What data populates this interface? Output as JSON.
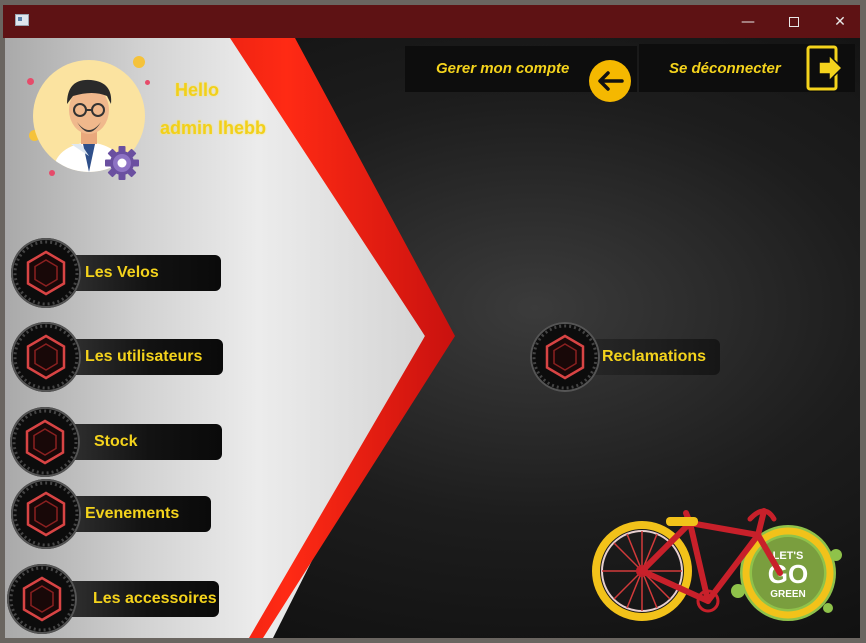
{
  "window": {
    "minimize_glyph": "—",
    "close_glyph": "✕"
  },
  "user": {
    "greeting": "Hello",
    "name": "admin lhebb"
  },
  "header": {
    "account_label": "Gerer mon compte",
    "logout_label": "Se déconnecter"
  },
  "menu": {
    "items": [
      {
        "label": "Les Velos"
      },
      {
        "label": "Les utilisateurs"
      },
      {
        "label": "Stock"
      },
      {
        "label": "Evenements"
      },
      {
        "label": "Les accessoires"
      }
    ],
    "reclamations_label": "Reclamations"
  },
  "badge": {
    "line1": "LET'S",
    "line2": "GO",
    "line3": "GREEN"
  },
  "colors": {
    "accent_yellow": "#f4d31c",
    "red": "#ff2a14",
    "title_bar": "#5e1214"
  }
}
